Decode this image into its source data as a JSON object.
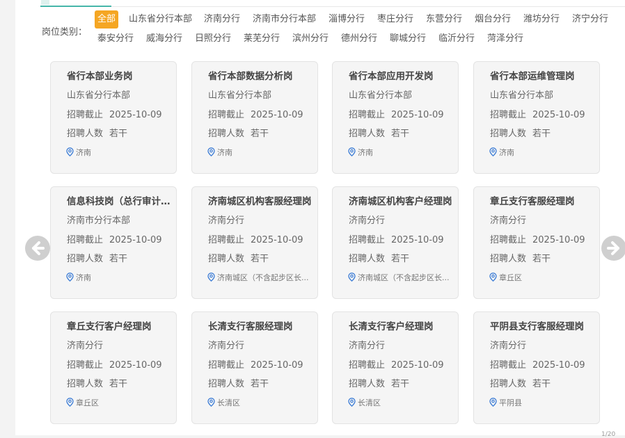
{
  "filter": {
    "label": "岗位类别：",
    "options": [
      "全部",
      "山东省分行本部",
      "济南分行",
      "济南市分行本部",
      "淄博分行",
      "枣庄分行",
      "东营分行",
      "烟台分行",
      "潍坊分行",
      "济宁分行",
      "泰安分行",
      "威海分行",
      "日照分行",
      "莱芜分行",
      "滨州分行",
      "德州分行",
      "聊城分行",
      "临沂分行",
      "菏泽分行"
    ],
    "selected": "全部"
  },
  "jobs": [
    {
      "title": "省行本部业务岗",
      "branch": "山东省分行本部",
      "deadline_label": "招聘截止",
      "deadline": "2025-10-09",
      "count_label": "招聘人数",
      "count": "若干",
      "location": "济南"
    },
    {
      "title": "省行本部数据分析岗",
      "branch": "山东省分行本部",
      "deadline_label": "招聘截止",
      "deadline": "2025-10-09",
      "count_label": "招聘人数",
      "count": "若干",
      "location": "济南"
    },
    {
      "title": "省行本部应用开发岗",
      "branch": "山东省分行本部",
      "deadline_label": "招聘截止",
      "deadline": "2025-10-09",
      "count_label": "招聘人数",
      "count": "若干",
      "location": "济南"
    },
    {
      "title": "省行本部运维管理岗",
      "branch": "山东省分行本部",
      "deadline_label": "招聘截止",
      "deadline": "2025-10-09",
      "count_label": "招聘人数",
      "count": "若干",
      "location": "济南"
    },
    {
      "title": "信息科技岗（总行审计储...",
      "branch": "济南市分行本部",
      "deadline_label": "招聘截止",
      "deadline": "2025-10-09",
      "count_label": "招聘人数",
      "count": "若干",
      "location": "济南"
    },
    {
      "title": "济南城区机构客服经理岗",
      "branch": "济南分行",
      "deadline_label": "招聘截止",
      "deadline": "2025-10-09",
      "count_label": "招聘人数",
      "count": "若干",
      "location": "济南城区（不含起步区长..."
    },
    {
      "title": "济南城区机构客户经理岗",
      "branch": "济南分行",
      "deadline_label": "招聘截止",
      "deadline": "2025-10-09",
      "count_label": "招聘人数",
      "count": "若干",
      "location": "济南城区（不含起步区长..."
    },
    {
      "title": "章丘支行客服经理岗",
      "branch": "济南分行",
      "deadline_label": "招聘截止",
      "deadline": "2025-10-09",
      "count_label": "招聘人数",
      "count": "若干",
      "location": "章丘区"
    },
    {
      "title": "章丘支行客户经理岗",
      "branch": "济南分行",
      "deadline_label": "招聘截止",
      "deadline": "2025-10-09",
      "count_label": "招聘人数",
      "count": "若干",
      "location": "章丘区"
    },
    {
      "title": "长清支行客服经理岗",
      "branch": "济南分行",
      "deadline_label": "招聘截止",
      "deadline": "2025-10-09",
      "count_label": "招聘人数",
      "count": "若干",
      "location": "长清区"
    },
    {
      "title": "长清支行客户经理岗",
      "branch": "济南分行",
      "deadline_label": "招聘截止",
      "deadline": "2025-10-09",
      "count_label": "招聘人数",
      "count": "若干",
      "location": "长清区"
    },
    {
      "title": "平阴县支行客服经理岗",
      "branch": "济南分行",
      "deadline_label": "招聘截止",
      "deadline": "2025-10-09",
      "count_label": "招聘人数",
      "count": "若干",
      "location": "平阴县"
    }
  ],
  "icons": {
    "prev": "arrow-left-circle-icon",
    "next": "arrow-right-circle-icon",
    "location": "map-pin-icon"
  },
  "colors": {
    "accent_active_chip": "#f5a623",
    "tab_underline": "#46b6a9",
    "pin": "#3a7bd5",
    "arrow_bg": "#cfcfcf"
  },
  "pager": {
    "text": "1/20"
  }
}
